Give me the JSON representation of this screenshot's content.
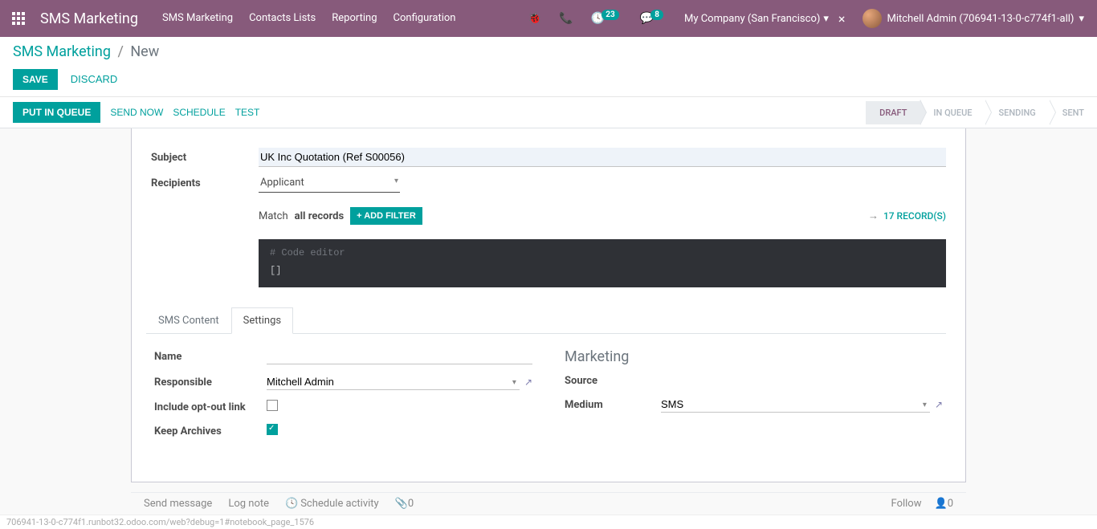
{
  "navbar": {
    "brand": "SMS Marketing",
    "links": [
      "SMS Marketing",
      "Contacts Lists",
      "Reporting",
      "Configuration"
    ],
    "activities_badge": "23",
    "messages_badge": "8",
    "company": "My Company (San Francisco)",
    "user": "Mitchell Admin (706941-13-0-c774f1-all)"
  },
  "breadcrumb": {
    "root": "SMS Marketing",
    "current": "New"
  },
  "buttons": {
    "save": "Save",
    "discard": "Discard",
    "put_in_queue": "Put in Queue",
    "send_now": "Send Now",
    "schedule": "Schedule",
    "test": "Test"
  },
  "statusbar": [
    "Draft",
    "In Queue",
    "Sending",
    "Sent"
  ],
  "form": {
    "subject_label": "Subject",
    "subject_value": "UK Inc Quotation (Ref S00056)",
    "recipients_label": "Recipients",
    "recipients_value": "Applicant",
    "match_prefix": "Match",
    "match_bold": "all records",
    "add_filter": "+ ADD FILTER",
    "records_count": "17 RECORD(S)",
    "code_comment": "# Code editor",
    "code_body": "[]"
  },
  "tabs": {
    "sms_content": "SMS Content",
    "settings": "Settings"
  },
  "settings": {
    "name_label": "Name",
    "responsible_label": "Responsible",
    "responsible_value": "Mitchell Admin",
    "optout_label": "Include opt-out link",
    "optout_checked": false,
    "archives_label": "Keep Archives",
    "archives_checked": true,
    "marketing_title": "Marketing",
    "source_label": "Source",
    "medium_label": "Medium",
    "medium_value": "SMS"
  },
  "chatter": {
    "send_message": "Send message",
    "log_note": "Log note",
    "schedule_activity": "Schedule activity",
    "attachments": "0",
    "follow": "Follow",
    "followers": "0"
  },
  "footer_url": "706941-13-0-c774f1.runbot32.odoo.com/web?debug=1#notebook_page_1576"
}
